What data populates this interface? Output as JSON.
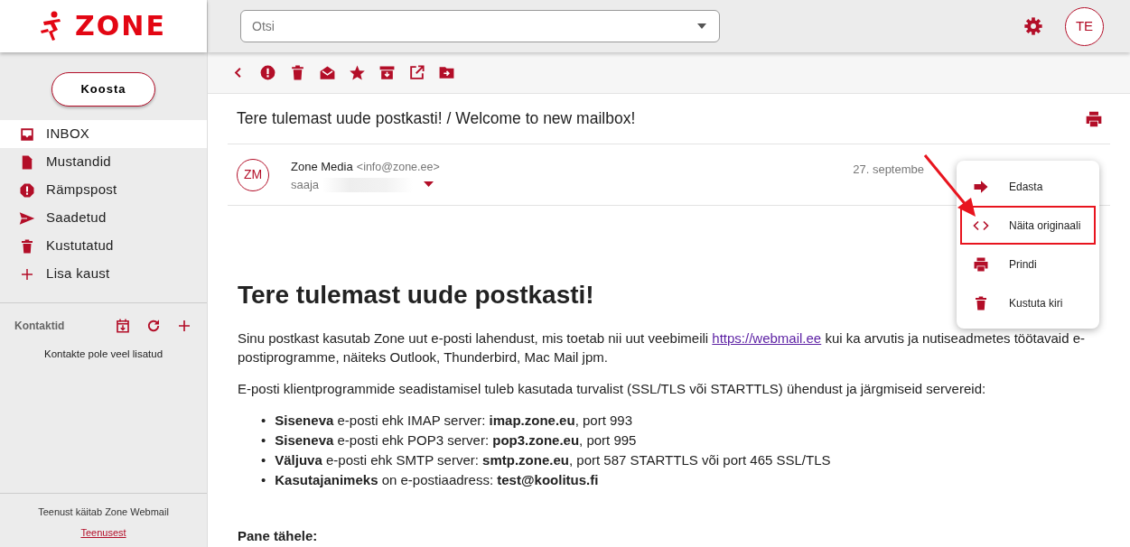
{
  "logo": {
    "text": "ZONE"
  },
  "header": {
    "search": {
      "placeholder": "Otsi"
    },
    "avatar": "TE"
  },
  "sidebar": {
    "compose": "Koosta",
    "folders": [
      {
        "label": "INBOX",
        "kind": "inbox",
        "selected": true
      },
      {
        "label": "Mustandid",
        "kind": "draft",
        "selected": false
      },
      {
        "label": "Rämpspost",
        "kind": "spam",
        "selected": false
      },
      {
        "label": "Saadetud",
        "kind": "sent",
        "selected": false
      },
      {
        "label": "Kustutatud",
        "kind": "trash",
        "selected": false
      },
      {
        "label": "Lisa kaust",
        "kind": "add",
        "selected": false
      }
    ],
    "contacts": {
      "title": "Kontaktid",
      "empty": "Kontakte pole veel lisatud"
    },
    "footer": {
      "text": "Teenust käitab Zone Webmail",
      "link": "Teenusest"
    }
  },
  "message": {
    "subject": "Tere tulemast uude postkasti! / Welcome to new mailbox!",
    "sender_initials": "ZM",
    "sender_name": "Zone Media",
    "sender_email": "<info@zone.ee>",
    "to_label": "saaja",
    "date": "27. septembe",
    "body": {
      "heading": "Tere tulemast uude postkasti!",
      "intro": {
        "before": "Sinu postkast kasutab Zone uut e-posti lahendust, mis toetab nii uut veebimeili ",
        "link": "https://webmail.ee",
        "after": " kui ka arvutis ja nutiseadmetes töötavaid e-postiprogramme, näiteks Outlook, Thunderbird, Mac Mail jpm."
      },
      "paragraph": "E-posti klientprogrammide seadistamisel tuleb kasutada turvalist (SSL/TLS või STARTTLS) ühendust ja järgmiseid servereid:",
      "list": [
        {
          "marker": "•",
          "text": "**Siseneva** e-posti ehk IMAP server: **imap.zone.eu**, port 993"
        },
        {
          "marker": "•",
          "text": "**Siseneva** e-posti ehk POP3 server: **pop3.zone.eu**, port 995"
        },
        {
          "marker": "•",
          "text": "**Väljuva** e-posti ehk SMTP server: **smtp.zone.eu**, port 587 STARTTLS või port 465 SSL/TLS"
        },
        {
          "marker": "•",
          "text": "**Kasutajanimeks** on e-postiaadress: **test@koolitus.fi**"
        }
      ],
      "note_heading": "Pane tähele:"
    }
  },
  "context_menu": [
    {
      "label": "Edasta",
      "kind": "forward",
      "highlighted": false
    },
    {
      "label": "Näita originaali",
      "kind": "code",
      "highlighted": true
    },
    {
      "label": "Prindi",
      "kind": "print",
      "highlighted": false
    },
    {
      "label": "Kustuta kiri",
      "kind": "trash",
      "highlighted": false
    }
  ]
}
